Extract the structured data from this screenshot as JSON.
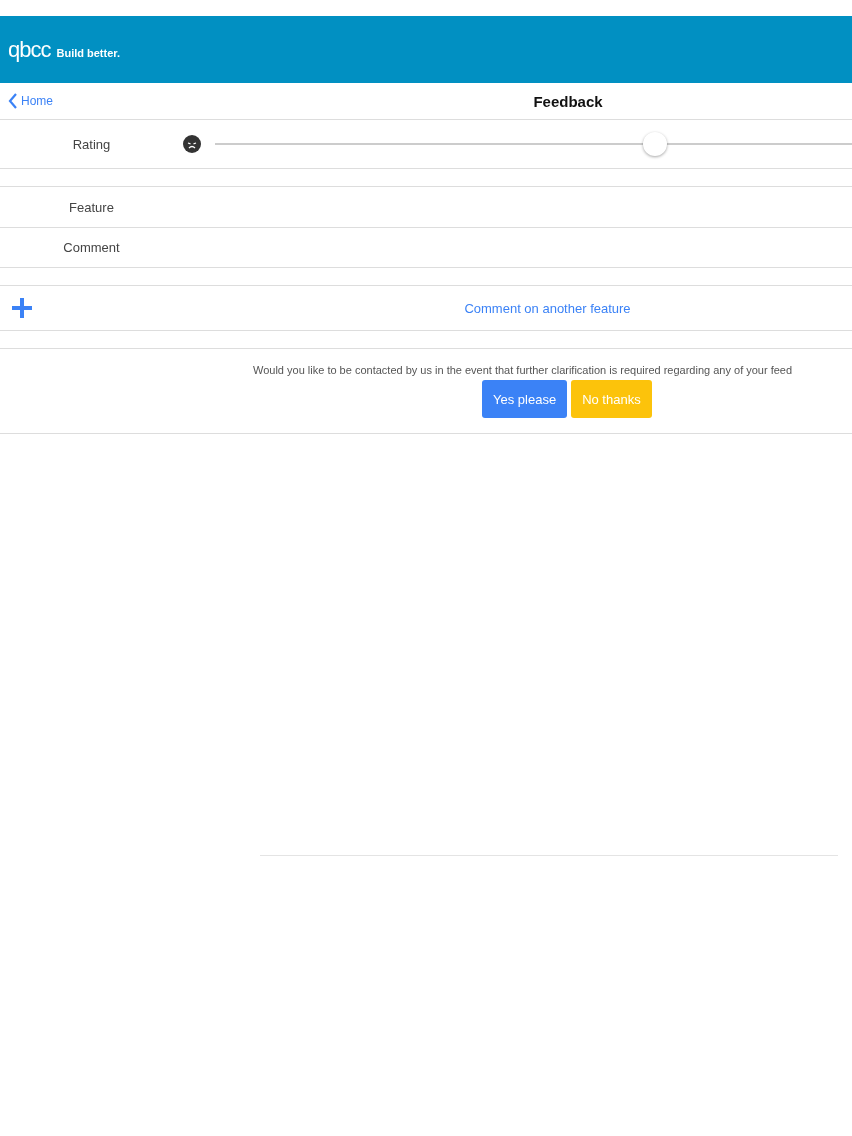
{
  "header": {
    "logo": "qbcc",
    "tagline": "Build better."
  },
  "nav": {
    "back": "Home",
    "title": "Feedback"
  },
  "rating": {
    "label": "Rating",
    "level": 0.69
  },
  "fields": [
    {
      "label": "Feature"
    },
    {
      "label": "Comment"
    }
  ],
  "add_feature": {
    "label": "Comment on another feature"
  },
  "contact": {
    "question": "Would you like to be contacted by us in the event that further clarification is required regarding any of your feed",
    "buttons": [
      {
        "label": "Yes please",
        "kind": "primary"
      },
      {
        "label": "No thanks",
        "kind": "warning"
      }
    ]
  }
}
